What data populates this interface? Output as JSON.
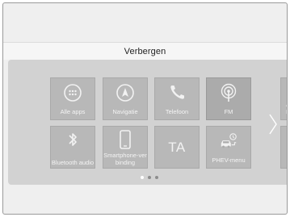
{
  "header": {
    "title": "Verbergen"
  },
  "tiles": [
    {
      "label": "Alle apps",
      "icon": "apps-grid-icon"
    },
    {
      "label": "Navigatie",
      "icon": "navigation-icon"
    },
    {
      "label": "Telefoon",
      "icon": "phone-icon"
    },
    {
      "label": "FM",
      "icon": "radio-antenna-icon",
      "selected": true
    },
    {
      "label": "Bluetooth audio",
      "icon": "bluetooth-icon"
    },
    {
      "label": "Smartphone-verbinding",
      "icon": "smartphone-icon"
    },
    {
      "label": "TA",
      "label2": "",
      "icon": ""
    },
    {
      "label": "PHEV-menu",
      "icon": "phev-car-icon"
    }
  ],
  "next_page_partial": {
    "line1": "A",
    "line2": "F"
  },
  "pager": {
    "pages": 3,
    "current": 1
  },
  "colors": {
    "panel": "#d2d2d2",
    "tile": "#b8b8b8",
    "tile_selected": "#ababab",
    "header_bar": "#f6f6f6"
  }
}
